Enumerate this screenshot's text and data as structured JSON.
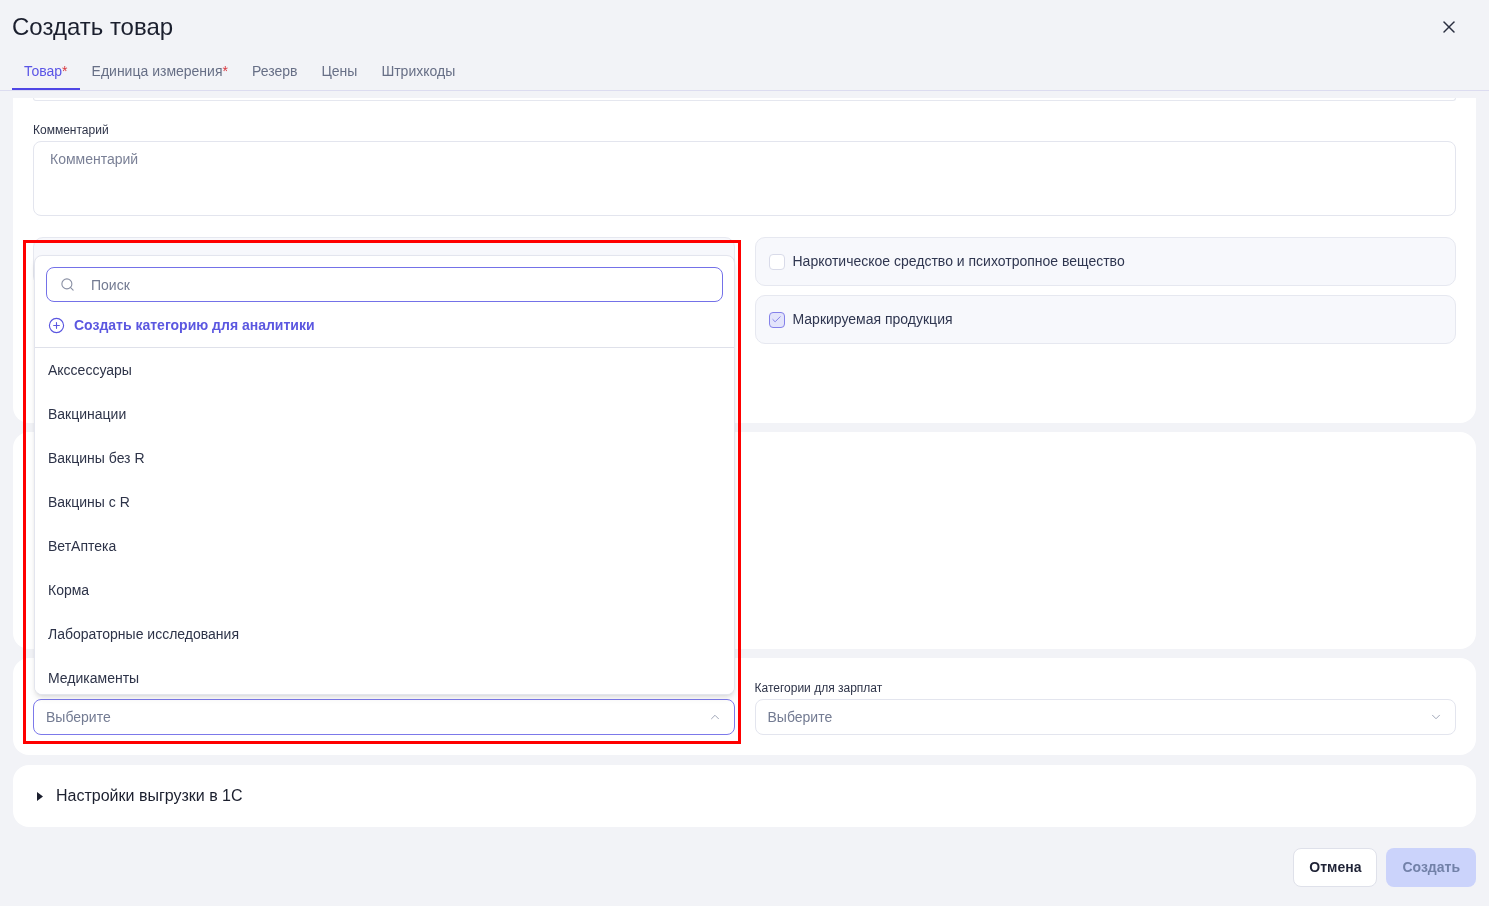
{
  "window": {
    "title": "Создать товар"
  },
  "tabs": [
    {
      "label": "Товар",
      "required_mark": "*",
      "selected": true
    },
    {
      "label": "Единица измерения",
      "required_mark": "*",
      "selected": false
    },
    {
      "label": "Резерв",
      "selected": false
    },
    {
      "label": "Цены",
      "selected": false
    },
    {
      "label": "Штрихкоды",
      "selected": false
    }
  ],
  "comment": {
    "label": "Комментарий",
    "placeholder": "Комментарий"
  },
  "flags": [
    {
      "label": "Наркотическое средство и психотропное вещество",
      "checked": false
    },
    {
      "label": "Маркируемая продукция",
      "checked": true
    }
  ],
  "analytics_category": {
    "placeholder": "Выберите",
    "expanded": true,
    "dropdown": {
      "search_placeholder": "Поиск",
      "create_label": "Создать категорию для аналитики",
      "options": [
        {
          "label": "Акссессуары",
          "selected": false
        },
        {
          "label": "Вакцинации",
          "selected": false
        },
        {
          "label": "Вакцины без R",
          "selected": false
        },
        {
          "label": "Вакцины с R",
          "selected": false
        },
        {
          "label": "ВетАптека",
          "selected": false
        },
        {
          "label": "Корма",
          "selected": false
        },
        {
          "label": "Лабораторные исследования",
          "selected": false
        },
        {
          "label": "Медикаменты",
          "selected": false
        }
      ]
    }
  },
  "salary_category": {
    "label": "Категории для зарплат",
    "placeholder": "Выберите",
    "expanded": false
  },
  "export_section": {
    "title": "Настройки выгрузки в 1С",
    "expanded": false
  },
  "buttons": [
    {
      "label": "Отмена",
      "kind": "secondary",
      "disabled": false
    },
    {
      "label": "Создать",
      "kind": "primary",
      "disabled": true
    }
  ]
}
